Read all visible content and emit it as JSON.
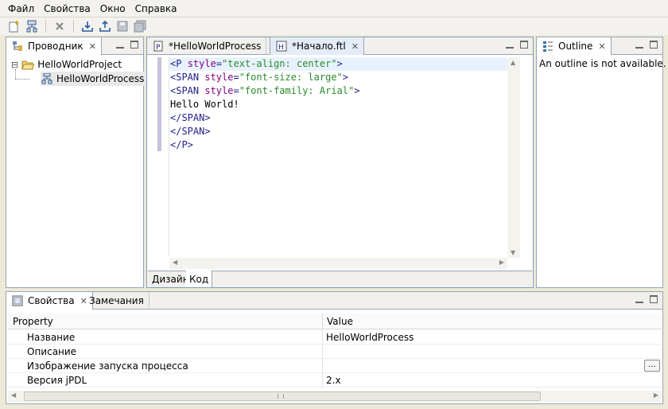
{
  "menu": [
    "Файл",
    "Свойства",
    "Окно",
    "Справка"
  ],
  "explorer": {
    "tab_label": "Проводник",
    "tree": [
      {
        "label": "HelloWorldProject",
        "expander": "⊟"
      },
      {
        "label": "HelloWorldProcess"
      }
    ]
  },
  "editor": {
    "tabs": [
      {
        "label": "*HelloWorldProcess",
        "icon": "P"
      },
      {
        "label": "*Начало.ftl",
        "icon": "H"
      }
    ],
    "code": [
      [
        {
          "t": "tag",
          "v": "<P "
        },
        {
          "t": "attr",
          "v": "style"
        },
        {
          "t": "tag",
          "v": "="
        },
        {
          "t": "str",
          "v": "\"text-align: center\""
        },
        {
          "t": "tag",
          "v": ">"
        }
      ],
      [
        {
          "t": "tag",
          "v": "<SPAN "
        },
        {
          "t": "attr",
          "v": "style"
        },
        {
          "t": "tag",
          "v": "="
        },
        {
          "t": "str",
          "v": "\"font-size: large\""
        },
        {
          "t": "tag",
          "v": ">"
        }
      ],
      [
        {
          "t": "tag",
          "v": "<SPAN "
        },
        {
          "t": "attr",
          "v": "style"
        },
        {
          "t": "tag",
          "v": "="
        },
        {
          "t": "str",
          "v": "\"font-family: Arial\""
        },
        {
          "t": "tag",
          "v": ">"
        }
      ],
      [
        {
          "t": "text",
          "v": "Hello World!"
        }
      ],
      [
        {
          "t": "tag",
          "v": "</SPAN>"
        }
      ],
      [
        {
          "t": "tag",
          "v": "</SPAN>"
        }
      ],
      [
        {
          "t": "tag",
          "v": "</P>"
        }
      ]
    ],
    "bottom_tabs": [
      "Дизайн",
      "Код"
    ]
  },
  "outline": {
    "tab_label": "Outline",
    "message": "An outline is not available."
  },
  "properties": {
    "tabs": [
      "Свойства",
      "Замечания"
    ],
    "col_property": "Property",
    "col_value": "Value",
    "rows": [
      {
        "name": "Название",
        "value": "HelloWorldProcess"
      },
      {
        "name": "Описание",
        "value": ""
      },
      {
        "name": "Изображение запуска процесса",
        "value": "",
        "button": "..."
      },
      {
        "name": "Версия jPDL",
        "value": "2.x"
      }
    ]
  },
  "colors": {
    "accent": "#3a6ea5",
    "tag": "#20208a",
    "attr": "#7f007f",
    "string": "#2a8a2a"
  },
  "icons": {
    "new": "new-file-icon",
    "process": "process-icon",
    "delete": "delete-icon",
    "import": "import-icon",
    "export": "export-icon",
    "save": "save-icon",
    "save_all": "save-all-icon"
  }
}
